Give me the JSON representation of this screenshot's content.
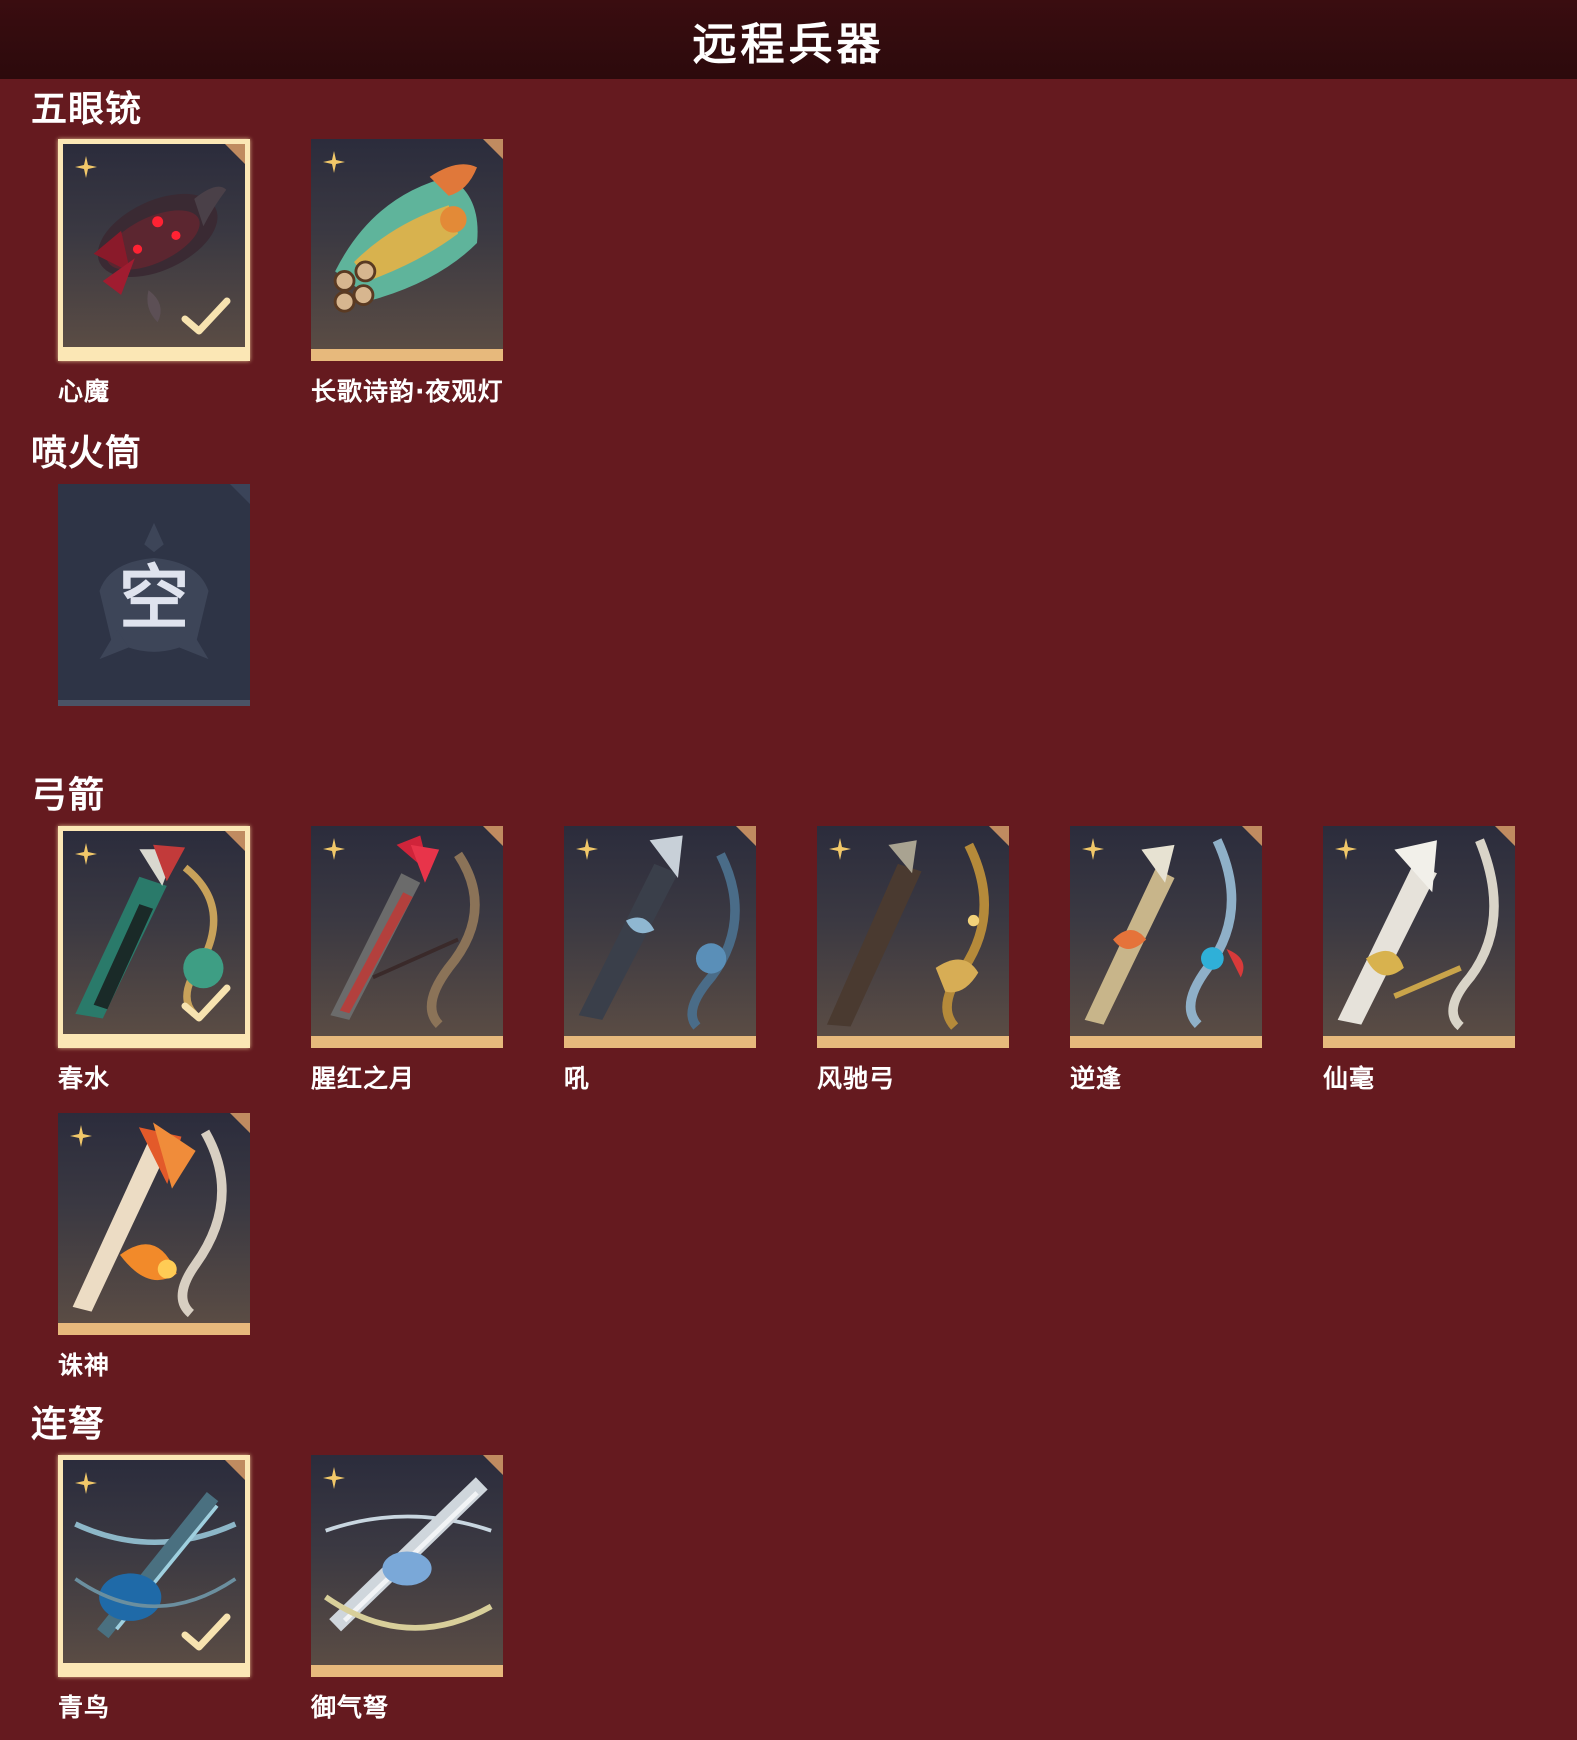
{
  "header": {
    "title": "远程兵器"
  },
  "sections": {
    "s0": {
      "title": "五眼铳",
      "items": [
        {
          "name": "心魔",
          "state": "selected",
          "art": "dark-red-demon-gun"
        },
        {
          "name": "长歌诗韵·夜观灯",
          "state": "owned",
          "art": "jade-fish-lantern-gun"
        }
      ]
    },
    "s1": {
      "title": "喷火筒",
      "items": [
        {
          "name": "",
          "state": "empty",
          "empty_label": "空"
        }
      ]
    },
    "s2": {
      "title": "弓箭",
      "items": [
        {
          "name": "春水",
          "state": "selected",
          "art": "jade-bow-quiver"
        },
        {
          "name": "腥红之月",
          "state": "owned",
          "art": "crimson-moon-bow"
        },
        {
          "name": "吼",
          "state": "owned",
          "art": "blue-cloud-bow"
        },
        {
          "name": "风驰弓",
          "state": "owned",
          "art": "golden-horse-bow"
        },
        {
          "name": "逆逢",
          "state": "owned",
          "art": "flame-blue-bow"
        },
        {
          "name": "仙毫",
          "state": "owned",
          "art": "white-feather-bow"
        },
        {
          "name": "诛神",
          "state": "owned",
          "art": "fire-feather-bow"
        }
      ]
    },
    "s3": {
      "title": "连弩",
      "items": [
        {
          "name": "青鸟",
          "state": "selected",
          "art": "blue-bird-crossbow"
        },
        {
          "name": "御气弩",
          "state": "owned",
          "art": "silver-qi-crossbow"
        }
      ]
    }
  },
  "colors": {
    "background": "#651a1f",
    "header": "#2c0a0c",
    "selected_frame": "#fbe7b5",
    "card_bottom": "#e7b97c",
    "empty_slot": "#2e3446"
  },
  "icons": {
    "rarity": "gold-four-point-star-icon",
    "equipped": "checkmark-icon",
    "empty": "crest-icon"
  }
}
